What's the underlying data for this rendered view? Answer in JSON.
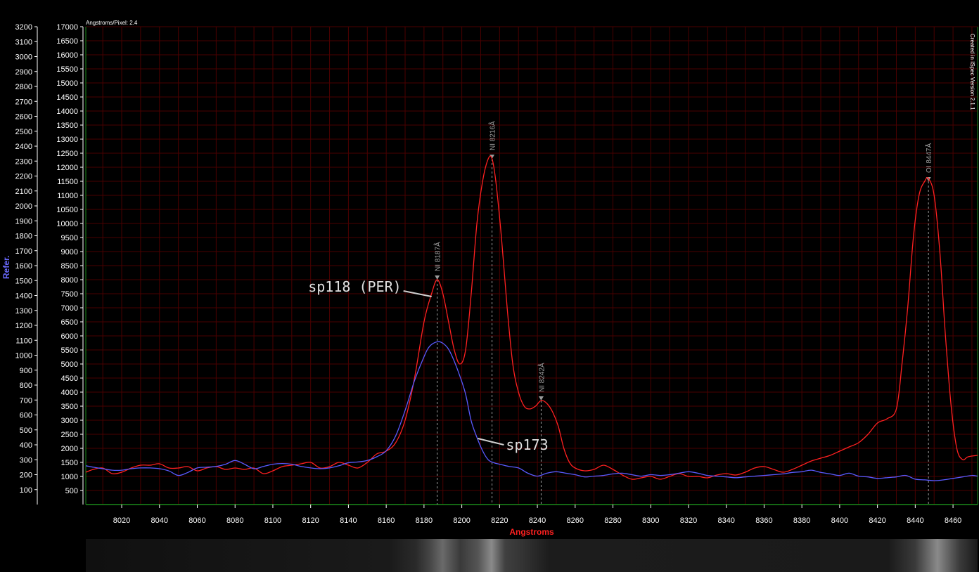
{
  "chart_data": {
    "type": "line",
    "header_note": "Angstroms/Pixel: 2.4",
    "side_note": "Created in ISpec Version 2.1.1",
    "xlabel": "Angstroms",
    "ylabel_left_outer": "Refer.",
    "xlim": [
      8001,
      8473
    ],
    "x_ticks": [
      8020,
      8040,
      8060,
      8080,
      8100,
      8120,
      8140,
      8160,
      8180,
      8200,
      8220,
      8240,
      8260,
      8280,
      8300,
      8320,
      8340,
      8360,
      8380,
      8400,
      8420,
      8440,
      8460
    ],
    "inner_axis": {
      "ylim": [
        0,
        17000
      ],
      "ticks": [
        500,
        1000,
        1500,
        2000,
        2500,
        3000,
        3500,
        4000,
        4500,
        5000,
        5500,
        6000,
        6500,
        7000,
        7500,
        8000,
        8500,
        9000,
        9500,
        10000,
        10500,
        11000,
        11500,
        12000,
        12500,
        13000,
        13500,
        14000,
        14500,
        15000,
        15500,
        16000,
        16500,
        17000
      ]
    },
    "outer_axis": {
      "ylim": [
        0,
        3200
      ],
      "ticks": [
        100,
        200,
        300,
        400,
        500,
        600,
        700,
        800,
        900,
        1000,
        1100,
        1200,
        1300,
        1400,
        1500,
        1600,
        1700,
        1800,
        1900,
        2000,
        2100,
        2200,
        2300,
        2400,
        2500,
        2600,
        2700,
        2800,
        2900,
        3000,
        3100,
        3200
      ]
    },
    "grid": true,
    "series": [
      {
        "name": "sp118 (PER)",
        "color": "#ff2020",
        "axis": "inner",
        "x": [
          8001,
          8005,
          8010,
          8015,
          8020,
          8025,
          8030,
          8035,
          8040,
          8045,
          8050,
          8055,
          8060,
          8065,
          8070,
          8075,
          8080,
          8085,
          8090,
          8095,
          8100,
          8105,
          8110,
          8115,
          8120,
          8125,
          8130,
          8135,
          8140,
          8145,
          8150,
          8155,
          8160,
          8165,
          8170,
          8175,
          8180,
          8184,
          8187,
          8190,
          8193,
          8196,
          8199,
          8202,
          8205,
          8208,
          8211,
          8214,
          8216,
          8218,
          8221,
          8224,
          8227,
          8230,
          8233,
          8236,
          8239,
          8242,
          8245,
          8248,
          8251,
          8254,
          8257,
          8260,
          8265,
          8270,
          8275,
          8280,
          8285,
          8290,
          8295,
          8300,
          8305,
          8310,
          8315,
          8320,
          8325,
          8330,
          8335,
          8340,
          8345,
          8350,
          8355,
          8360,
          8365,
          8370,
          8375,
          8380,
          8385,
          8390,
          8395,
          8400,
          8405,
          8410,
          8415,
          8420,
          8425,
          8430,
          8433,
          8436,
          8439,
          8442,
          8445,
          8447,
          8450,
          8453,
          8456,
          8459,
          8462,
          8465,
          8468,
          8473
        ],
        "y": [
          1150,
          1250,
          1300,
          1100,
          1150,
          1300,
          1400,
          1400,
          1450,
          1300,
          1300,
          1350,
          1200,
          1300,
          1350,
          1250,
          1300,
          1250,
          1300,
          1100,
          1200,
          1350,
          1400,
          1450,
          1500,
          1300,
          1350,
          1500,
          1400,
          1300,
          1500,
          1800,
          1900,
          2200,
          3000,
          4500,
          6500,
          7500,
          8000,
          7500,
          6500,
          5500,
          5000,
          5500,
          7500,
          10000,
          11500,
          12300,
          12300,
          11500,
          9500,
          7000,
          5000,
          4000,
          3500,
          3400,
          3500,
          3700,
          3600,
          3300,
          2800,
          2000,
          1500,
          1300,
          1200,
          1250,
          1400,
          1250,
          1050,
          900,
          950,
          1000,
          900,
          1000,
          1100,
          1000,
          1000,
          950,
          1050,
          1100,
          1050,
          1150,
          1300,
          1350,
          1250,
          1150,
          1250,
          1400,
          1550,
          1650,
          1750,
          1900,
          2050,
          2200,
          2500,
          2900,
          3050,
          3400,
          5000,
          7000,
          9500,
          11000,
          11500,
          11600,
          11000,
          9000,
          6000,
          3500,
          2000,
          1600,
          1700,
          1750
        ]
      },
      {
        "name": "sp173",
        "color": "#5a5aff",
        "axis": "outer",
        "x": [
          8001,
          8005,
          8010,
          8015,
          8020,
          8025,
          8030,
          8035,
          8040,
          8045,
          8050,
          8055,
          8060,
          8065,
          8070,
          8075,
          8080,
          8085,
          8090,
          8095,
          8100,
          8105,
          8110,
          8115,
          8120,
          8125,
          8130,
          8135,
          8140,
          8145,
          8150,
          8155,
          8160,
          8165,
          8170,
          8175,
          8180,
          8183,
          8187,
          8190,
          8193,
          8196,
          8199,
          8202,
          8205,
          8208,
          8211,
          8214,
          8217,
          8220,
          8225,
          8230,
          8235,
          8240,
          8245,
          8250,
          8255,
          8260,
          8265,
          8270,
          8275,
          8280,
          8285,
          8290,
          8295,
          8300,
          8305,
          8310,
          8315,
          8320,
          8325,
          8330,
          8335,
          8340,
          8345,
          8350,
          8355,
          8360,
          8365,
          8370,
          8375,
          8380,
          8385,
          8390,
          8395,
          8400,
          8405,
          8410,
          8415,
          8420,
          8425,
          8430,
          8435,
          8440,
          8445,
          8450,
          8455,
          8460,
          8465,
          8470,
          8473
        ],
        "y": [
          260,
          250,
          240,
          230,
          230,
          240,
          245,
          245,
          240,
          225,
          195,
          215,
          245,
          250,
          255,
          270,
          295,
          270,
          240,
          255,
          270,
          275,
          270,
          255,
          245,
          240,
          245,
          260,
          280,
          285,
          295,
          320,
          360,
          460,
          630,
          830,
          990,
          1060,
          1090,
          1080,
          1040,
          960,
          860,
          740,
          560,
          450,
          360,
          300,
          280,
          270,
          255,
          245,
          210,
          190,
          210,
          220,
          210,
          200,
          185,
          190,
          195,
          205,
          210,
          200,
          190,
          200,
          195,
          200,
          210,
          220,
          210,
          195,
          190,
          185,
          180,
          185,
          190,
          195,
          200,
          205,
          215,
          220,
          230,
          215,
          205,
          195,
          210,
          190,
          185,
          175,
          180,
          185,
          195,
          170,
          165,
          160,
          165,
          175,
          185,
          195,
          190
        ]
      }
    ],
    "line_markers": [
      {
        "label": "NI 8187Å",
        "x": 8187,
        "y": 8000
      },
      {
        "label": "NI 8216Å",
        "x": 8216,
        "y": 12300
      },
      {
        "label": "NI 8242Å",
        "x": 8242,
        "y": 3700
      },
      {
        "label": "OI 8447Å",
        "x": 8447,
        "y": 11500
      }
    ],
    "annotations": [
      {
        "text": "sp118 (PER)",
        "x": 8187,
        "y": 7400
      },
      {
        "text": "sp173",
        "x": 8207,
        "y": 2350
      }
    ]
  }
}
